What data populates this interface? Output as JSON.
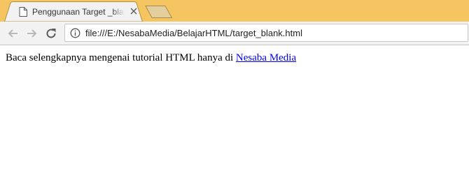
{
  "tab": {
    "title": "Penggunaan Target _blank",
    "icon": "document-icon",
    "active_color": "#f2f2f2"
  },
  "tabstrip": {
    "background": "#f4c561"
  },
  "toolbar": {
    "back_icon": "back-arrow-icon",
    "forward_icon": "forward-arrow-icon",
    "reload_icon": "reload-icon"
  },
  "omnibox": {
    "info_icon": "info-icon",
    "url": "file:///E:/NesabaMedia/BelajarHTML/target_blank.html"
  },
  "page": {
    "text": "Baca selengkapnya mengenai tutorial HTML hanya di ",
    "link_text": "Nesaba Media",
    "link_color": "#0000ee"
  }
}
